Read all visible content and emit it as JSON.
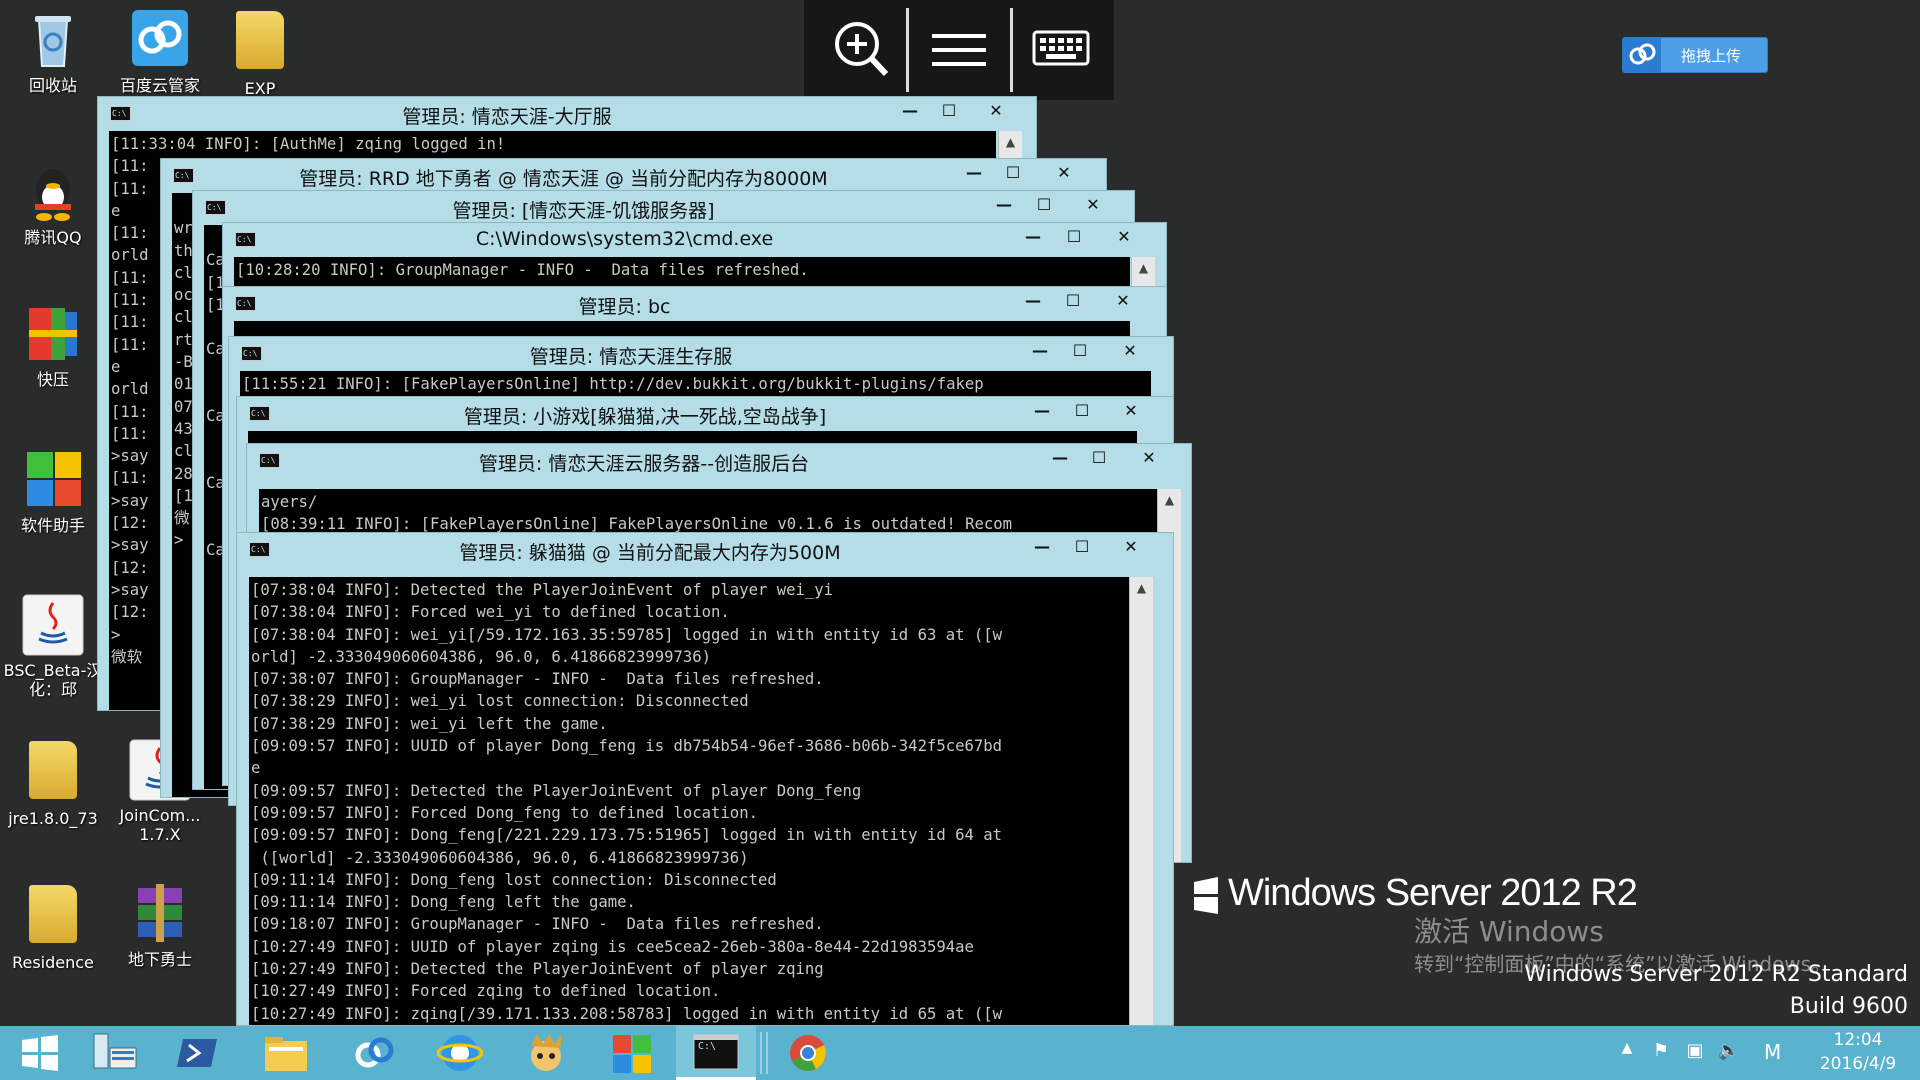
{
  "desktop_icons": [
    {
      "label": "回收站",
      "kind": "recycle-bin"
    },
    {
      "label": "百度云管家",
      "kind": "baidu-cloud"
    },
    {
      "label": "EXP",
      "kind": "folder"
    },
    {
      "label": "腾讯QQ",
      "kind": "qq"
    },
    {
      "label": "快压",
      "kind": "kuaiya"
    },
    {
      "label": "软件助手",
      "kind": "software-helper"
    },
    {
      "label": "BSC_Beta-汉化：邱",
      "kind": "java"
    },
    {
      "label": "jre1.8.0_73",
      "kind": "folder"
    },
    {
      "label": "JoinCom...\n1.7.X",
      "kind": "java"
    },
    {
      "label": "Residence",
      "kind": "folder"
    },
    {
      "label": "地下勇士",
      "kind": "winrar"
    }
  ],
  "remote_toolbar": {
    "zoom": "zoom-in-icon",
    "menu": "menu-icon",
    "keyboard": "keyboard-icon"
  },
  "upload_button": {
    "label": "拖拽上传"
  },
  "windows": {
    "w1": {
      "title": "管理员: 情恋天涯-大厅服",
      "text": "[11:33:04 INFO]: [AuthMe] zqing logged in!\n[11:\n[11:\ne\n[11:\norld\n[11:\n[11:\n[11:\n[11:\ne\norld\n[11:\n[11:\n>say\n[11:\n>say\n[12:\n>say\n[12:\n>say\n[12:\n>\n微软"
    },
    "w2": {
      "title": "管理员: RRD 地下勇者 @ 情恋天涯 @ 当前分配内存为8000M",
      "text": "\nwr\nth\ncl\noc\ncl\nrt\n-B\n01\n07\n43\ncl\n28\n[1\n微\n>"
    },
    "w3": {
      "title": "管理员: [情恋天涯-饥饿服务器]",
      "text": "\nCa\n[1\n[1\n\nCa\n\n\nCa\n\n\nCa\n\n\nCa"
    },
    "w4": {
      "title": "C:\\Windows\\system32\\cmd.exe",
      "text": "[10:28:20 INFO]: GroupManager - INFO -  Data files refreshed."
    },
    "w5": {
      "title": "管理员: bc",
      "text": ""
    },
    "w6": {
      "title": "管理员: 情恋天涯生存服",
      "text": "[11:55:21 INFO]: [FakePlayersOnline] http://dev.bukkit.org/bukkit-plugins/fakep"
    },
    "w7": {
      "title": "管理员: 小游戏[躲猫猫,决一死战,空岛战争]",
      "text": ""
    },
    "w8": {
      "title": "管理员: 情恋天涯云服务器--创造服后台",
      "text": "ayers/\n[08:39:11 INFO]: [FakePlayersOnline] FakePlayersOnline v0.1.6 is outdated! Recom"
    },
    "w9": {
      "title": "管理员: 躲猫猫 @ 当前分配最大内存为500M",
      "text": "[07:38:04 INFO]: Detected the PlayerJoinEvent of player wei_yi\n[07:38:04 INFO]: Forced wei_yi to defined location.\n[07:38:04 INFO]: wei_yi[/59.172.163.35:59785] logged in with entity id 63 at ([w\norld] -2.333049060604386, 96.0, 6.41866823999736)\n[07:38:07 INFO]: GroupManager - INFO -  Data files refreshed.\n[07:38:29 INFO]: wei_yi lost connection: Disconnected\n[07:38:29 INFO]: wei_yi left the game.\n[09:09:57 INFO]: UUID of player Dong_feng is db754b54-96ef-3686-b06b-342f5ce67bd\ne\n[09:09:57 INFO]: Detected the PlayerJoinEvent of player Dong_feng\n[09:09:57 INFO]: Forced Dong_feng to defined location.\n[09:09:57 INFO]: Dong_feng[/221.229.173.75:51965] logged in with entity id 64 at\n ([world] -2.333049060604386, 96.0, 6.41866823999736)\n[09:11:14 INFO]: Dong_feng lost connection: Disconnected\n[09:11:14 INFO]: Dong_feng left the game.\n[09:18:07 INFO]: GroupManager - INFO -  Data files refreshed.\n[10:27:49 INFO]: UUID of player zqing is cee5cea2-26eb-380a-8e44-22d1983594ae\n[10:27:49 INFO]: Detected the PlayerJoinEvent of player zqing\n[10:27:49 INFO]: Forced zqing to defined location.\n[10:27:49 INFO]: zqing[/39.171.133.208:58783] logged in with entity id 65 at ([w"
    }
  },
  "watermark": {
    "product": "Windows Server 2012 R2",
    "activate": "激活 Windows",
    "activate_hint": "转到“控制面板”中的“系统”以激活 Windows。",
    "edition": "Windows Server 2012 R2 Standard",
    "build": "Build 9600"
  },
  "taskbar": {
    "apps": [
      "start-icon",
      "server-manager-icon",
      "powershell-icon",
      "file-explorer-icon",
      "baidu-cloud-icon",
      "ie-icon",
      "game-icon",
      "windows-store-icon",
      "cmd-icon",
      "chrome-icon"
    ],
    "ime": "M",
    "time": "12:04",
    "date": "2016/4/9"
  },
  "colors": {
    "desktop": "#2a2c2c",
    "taskbar": "#5ab3ce",
    "window_frame": "#b4dde7",
    "console": "#000000"
  }
}
